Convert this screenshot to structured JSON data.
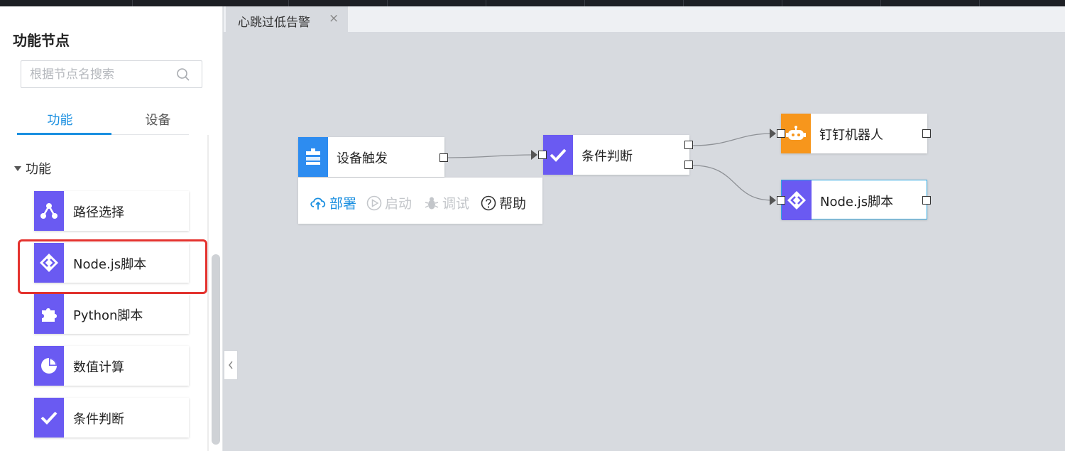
{
  "sidebar": {
    "title": "功能节点",
    "search_placeholder": "根据节点名搜索",
    "tabs": [
      "功能",
      "设备"
    ],
    "section": "功能",
    "items": [
      {
        "label": "路径选择",
        "icon": "route-icon"
      },
      {
        "label": "Node.js脚本",
        "icon": "code-icon"
      },
      {
        "label": "Python脚本",
        "icon": "puzzle-icon"
      },
      {
        "label": "数值计算",
        "icon": "pie-icon"
      },
      {
        "label": "条件判断",
        "icon": "check-icon"
      }
    ]
  },
  "editor": {
    "tab_title": "心跳过低告警",
    "close_symbol": "×"
  },
  "flow": {
    "nodes": [
      {
        "label": "设备触发",
        "icon": "device-trigger-icon",
        "color": "#2d8cf0"
      },
      {
        "label": "条件判断",
        "icon": "check-icon",
        "color": "#6a5af2"
      },
      {
        "label": "钉钉机器人",
        "icon": "robot-icon",
        "color": "#f7961c"
      },
      {
        "label": "Node.js脚本",
        "icon": "code-icon",
        "color": "#6a5af2"
      }
    ],
    "toolbar": {
      "deploy": "部署",
      "start": "启动",
      "debug": "调试",
      "help": "帮助"
    }
  },
  "colors": {
    "accent": "#1a8fe0",
    "node_purple": "#6a5af2",
    "highlight_red": "#e4332f",
    "canvas": "#d7dadf"
  }
}
